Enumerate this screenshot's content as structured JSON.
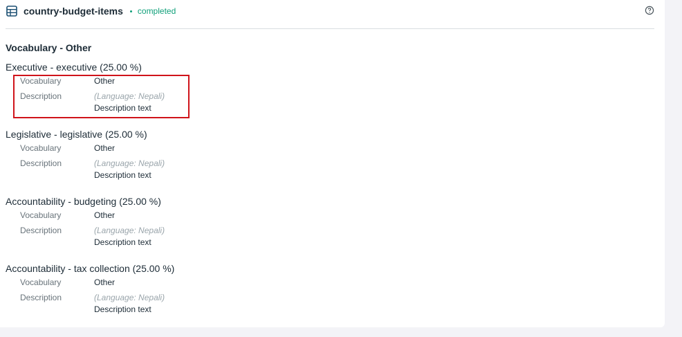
{
  "header": {
    "element_name": "country-budget-items",
    "status": "completed",
    "icon": "database-icon",
    "help_icon": "help-circle-icon"
  },
  "section": {
    "title": "Vocabulary - Other"
  },
  "labels": {
    "vocabulary": "Vocabulary",
    "description": "Description"
  },
  "items": [
    {
      "title": "Executive - executive (25.00 %)",
      "vocabulary": "Other",
      "language": "(Language: Nepali)",
      "description": "Description text"
    },
    {
      "title": "Legislative - legislative (25.00 %)",
      "vocabulary": "Other",
      "language": "(Language: Nepali)",
      "description": "Description text"
    },
    {
      "title": "Accountability - budgeting (25.00 %)",
      "vocabulary": "Other",
      "language": "(Language: Nepali)",
      "description": "Description text"
    },
    {
      "title": "Accountability - tax collection (25.00 %)",
      "vocabulary": "Other",
      "language": "(Language: Nepali)",
      "description": "Description text"
    }
  ],
  "colors": {
    "status": "#0e9f79",
    "highlight": "#d0131a",
    "icon": "#1b4f72"
  }
}
